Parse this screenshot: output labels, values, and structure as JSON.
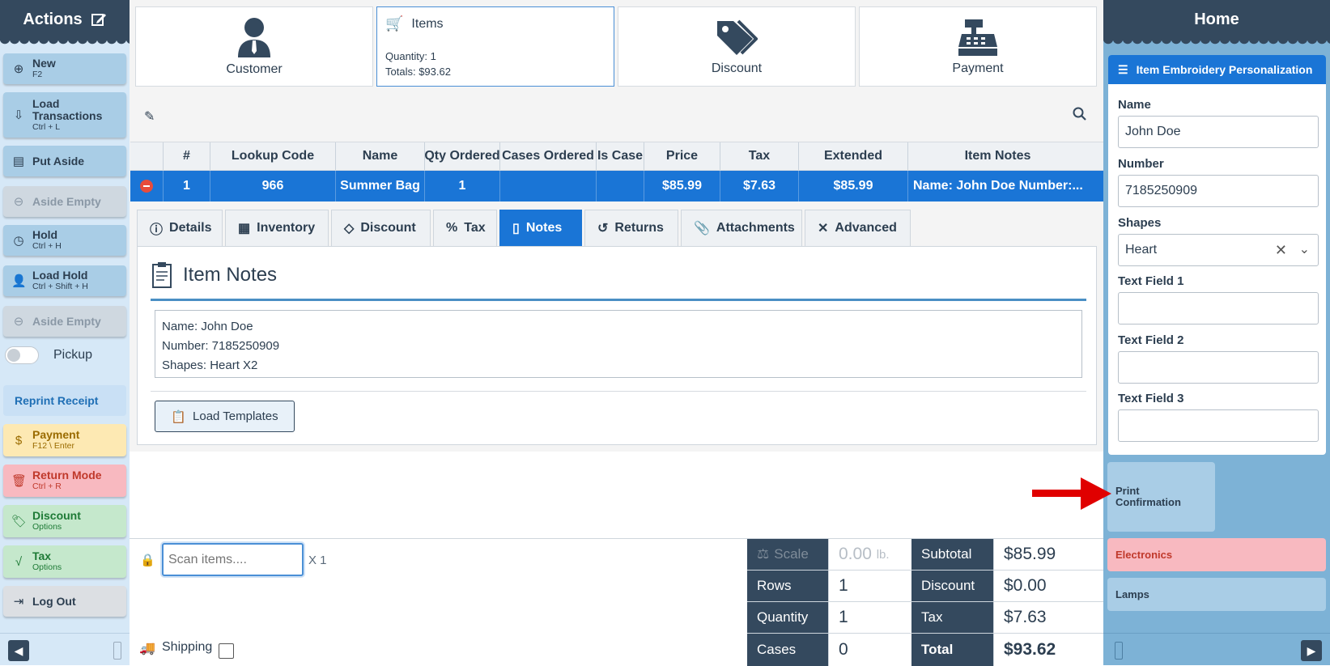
{
  "left": {
    "title": "Actions",
    "buttons": [
      {
        "label": "New",
        "hint": "F2"
      },
      {
        "label": "Load Transactions",
        "hint": "Ctrl + L"
      },
      {
        "label": "Put Aside",
        "hint": ""
      },
      {
        "label": "Aside Empty",
        "hint": ""
      },
      {
        "label": "Hold",
        "hint": "Ctrl + H"
      },
      {
        "label": "Load Hold",
        "hint": "Ctrl + Shift + H"
      },
      {
        "label": "Aside Empty",
        "hint": ""
      }
    ],
    "pickup_label": "Pickup",
    "reprint_label": "Reprint Receipt",
    "payment": {
      "label": "Payment",
      "hint": "F12 \\ Enter"
    },
    "return_mode": {
      "label": "Return Mode",
      "hint": "Ctrl + R"
    },
    "discount": {
      "label": "Discount",
      "hint": "Options"
    },
    "tax": {
      "label": "Tax",
      "hint": "Options"
    },
    "logout_label": "Log Out"
  },
  "cards": {
    "customer": "Customer",
    "items": {
      "label": "Items",
      "qty_label": "Quantity:",
      "qty": "1",
      "totals_label": "Totals:",
      "totals": "$93.62"
    },
    "discount": "Discount",
    "payment": "Payment"
  },
  "grid": {
    "headers": [
      "#",
      "Lookup Code",
      "Name",
      "Qty Ordered",
      "Cases Ordered",
      "Is Case",
      "Price",
      "Tax",
      "Extended",
      "Item Notes"
    ],
    "row": [
      "1",
      "966",
      "Summer Bag",
      "1",
      "",
      "",
      "$85.99",
      "$7.63",
      "$85.99",
      "Name: John Doe Number:..."
    ]
  },
  "tabs": [
    "Details",
    "Inventory",
    "Discount",
    "Tax",
    "Notes",
    "Returns",
    "Attachments",
    "Advanced"
  ],
  "notes": {
    "title": "Item Notes",
    "lines": [
      "Name: John Doe",
      "Number: 7185250909",
      "Shapes: Heart X2"
    ],
    "load_templates": "Load Templates"
  },
  "scan": {
    "placeholder": "Scan items....",
    "multiplier": "X 1",
    "shipping_label": "Shipping"
  },
  "summary": {
    "scale_label": "Scale",
    "scale_value": "0.00",
    "scale_unit": "lb.",
    "rows_label": "Rows",
    "rows": "1",
    "quantity_label": "Quantity",
    "quantity": "1",
    "cases_label": "Cases",
    "cases": "0",
    "subtotal_label": "Subtotal",
    "subtotal": "$85.99",
    "discount_label": "Discount",
    "discount": "$0.00",
    "tax_label": "Tax",
    "tax": "$7.63",
    "total_label": "Total",
    "total": "$93.62"
  },
  "right": {
    "title": "Home",
    "form_title": "Item Embroidery Personalization",
    "name_label": "Name",
    "name_value": "John Doe",
    "number_label": "Number",
    "number_value": "7185250909",
    "shapes_label": "Shapes",
    "shapes_value": "Heart",
    "text1_label": "Text Field 1",
    "text2_label": "Text Field 2",
    "text3_label": "Text Field 3",
    "print_label": "Print Confirmation",
    "electronics_label": "Electronics",
    "lamps_label": "Lamps"
  },
  "colors": {
    "primary": "#1a75d6",
    "header": "#34495e",
    "arrow": "#e00000"
  }
}
